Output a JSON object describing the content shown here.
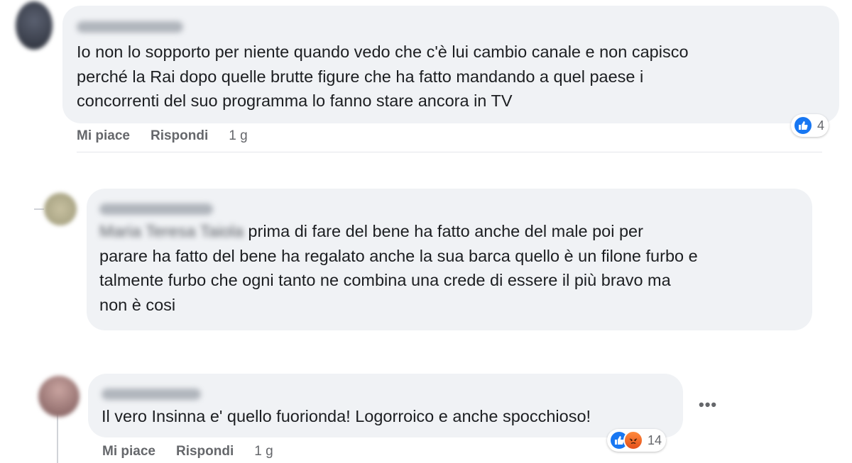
{
  "comments": [
    {
      "author": "",
      "text": "Io non lo sopporto per niente quando vedo che c'è lui cambio canale e non capisco\nperché la Rai dopo quelle brutte figure che ha fatto mandando a quel paese i\nconcorrenti del suo programma lo fanno stare ancora in TV",
      "like_label": "Mi piace",
      "reply_label": "Rispondi",
      "time": "1 g",
      "reaction_count": "4",
      "reactions": [
        "like-icon"
      ]
    },
    {
      "author": "",
      "tagged_name": "Maria Teresa Taiola",
      "text_after_tag": " prima di fare del bene ha fatto anche del male poi per\nparare ha fatto del bene ha regalato anche la sua barca quello è un filone furbo e\ntalmente furbo che ogni tanto ne combina una crede di essere il più bravo ma\nnon è cosi"
    },
    {
      "author": "",
      "text": "Il vero Insinna e' quello fuorionda! Logorroico e anche spocchioso!",
      "like_label": "Mi piace",
      "reply_label": "Rispondi",
      "time": "1 g",
      "reaction_count": "14",
      "reactions": [
        "like-icon",
        "angry-icon"
      ],
      "more_label": "•••"
    }
  ],
  "colors": {
    "bubble": "#f0f2f5",
    "like_blue": "#1877f2",
    "meta_gray": "#65676b"
  }
}
